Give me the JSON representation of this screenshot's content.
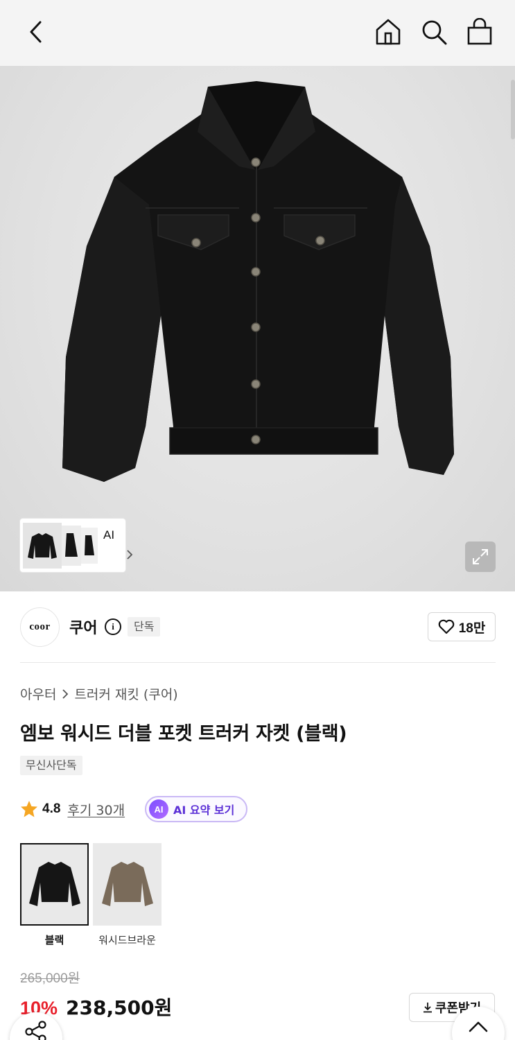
{
  "header": {
    "back_icon": "chevron-left-icon",
    "home_icon": "home-icon",
    "search_icon": "search-icon",
    "cart_icon": "shopping-bag-icon"
  },
  "gallery": {
    "ai_label": "AI",
    "ai_chevron_icon": "chevron-right-icon",
    "expand_icon": "expand-icon"
  },
  "brand": {
    "logo_text": "coor",
    "name": "쿠어",
    "info_icon": "info-icon",
    "badge": "단독",
    "like_icon": "heart-icon",
    "like_count": "18만"
  },
  "product": {
    "breadcrumb": [
      "아우터",
      "트러커 재킷 (쿠어)"
    ],
    "title": "엠보 워시드 더블 포켓 트러커 자켓 (블랙)",
    "exclusive_tag": "무신사단독",
    "rating": "4.8",
    "reviews": "후기 30개",
    "ai_summary": {
      "icon_text": "AI",
      "label": "AI 요약 보기"
    },
    "colors": [
      {
        "name": "블랙",
        "selected": true,
        "color": "#111111"
      },
      {
        "name": "워시드브라운",
        "selected": false,
        "color": "#7a6b5a"
      }
    ],
    "original_price": "265,000원",
    "discount": "10%",
    "sale_price": "238,500원",
    "coupon_label": "쿠폰받기"
  },
  "floating": {
    "share_icon": "share-icon",
    "scroll_top_icon": "chevron-up-icon"
  },
  "colors": {
    "discount_red": "#e8202b",
    "ai_purple": "#5b2fd6",
    "star_orange": "#f5a623"
  }
}
